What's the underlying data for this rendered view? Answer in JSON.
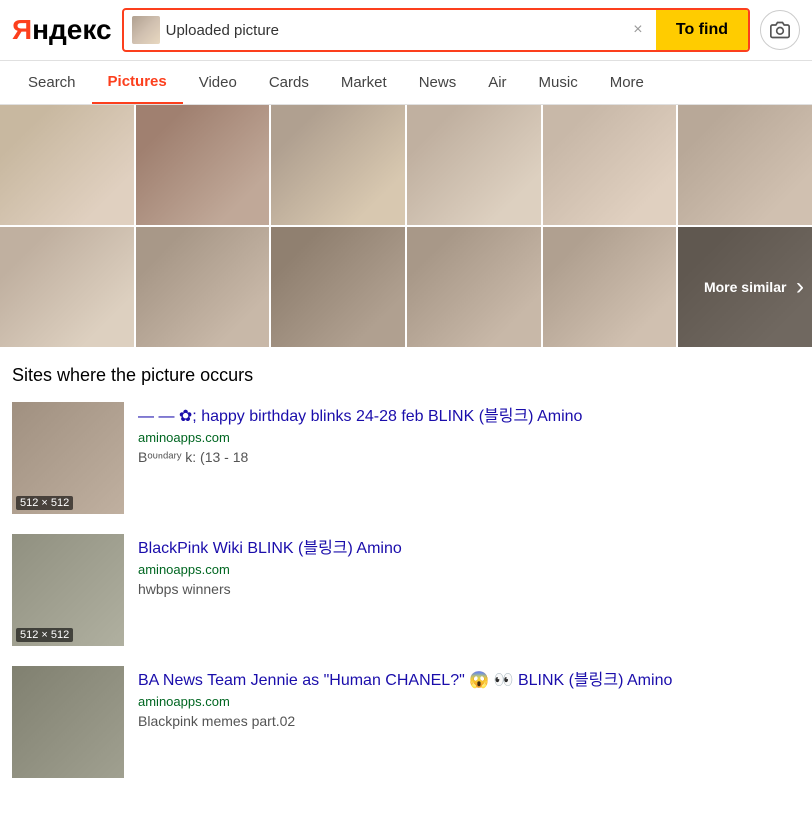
{
  "logo": {
    "text_red": "Яндекс",
    "dot": "."
  },
  "search": {
    "uploaded_label": "Uploaded picture",
    "to_find_label": "To find",
    "close_label": "×"
  },
  "nav": {
    "items": [
      {
        "label": "Search",
        "active": false
      },
      {
        "label": "Pictures",
        "active": true
      },
      {
        "label": "Video",
        "active": false
      },
      {
        "label": "Cards",
        "active": false
      },
      {
        "label": "Market",
        "active": false
      },
      {
        "label": "News",
        "active": false
      },
      {
        "label": "Air",
        "active": false
      },
      {
        "label": "Music",
        "active": false
      },
      {
        "label": "More",
        "active": false
      }
    ]
  },
  "more_similar": {
    "label": "More similar",
    "chevron": "›"
  },
  "sites": {
    "title": "Sites where the picture occurs",
    "results": [
      {
        "id": 1,
        "thumb_size": "512 × 512",
        "title": "— — ✿; happy birthday blinks 24-28 feb BLINK (블링크) Amino",
        "url": "aminoapps.com",
        "desc": "Вᵒᶸⁿᵈᵃʳʸ k: (13 - 18"
      },
      {
        "id": 2,
        "thumb_size": "512 × 512",
        "title": "BlackPink Wiki BLINK (블링크) Amino",
        "url": "aminoapps.com",
        "desc": "hwbps winners"
      },
      {
        "id": 3,
        "thumb_size": null,
        "title": "BA News Team Jennie as \"Human CHANEL?\" 😱 👀 BLINK (블링크) Amino",
        "url": "aminoapps.com",
        "desc": "Blackpink memes part.02"
      }
    ]
  }
}
